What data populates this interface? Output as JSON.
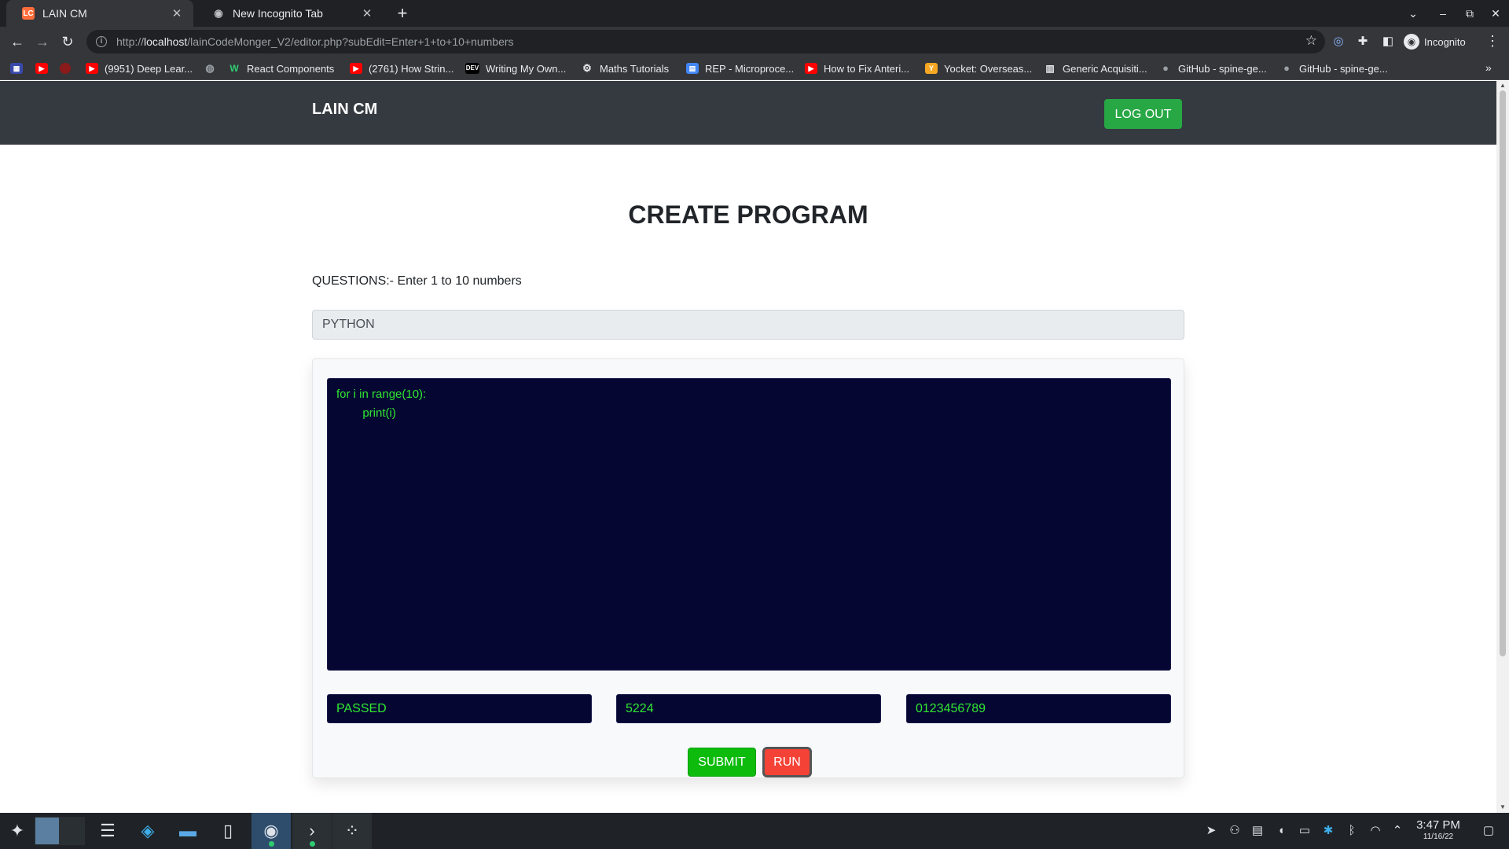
{
  "browser": {
    "tabs": [
      {
        "label": "LAIN CM",
        "favicon": "LC"
      },
      {
        "label": "New Incognito Tab",
        "favicon": "incognito-icon"
      }
    ],
    "url_prefix": "http://",
    "url_host": "localhost",
    "url_path": "/lainCodeMonger_V2/editor.php?subEdit=Enter+1+to+10+numbers",
    "profile_label": "Incognito",
    "bookmarks": [
      {
        "label": "",
        "icon": "calendar-icon"
      },
      {
        "label": "",
        "icon": "youtube-icon"
      },
      {
        "label": "",
        "icon": "circle-icon"
      },
      {
        "label": "(9951) Deep Lear...",
        "icon": "youtube-icon"
      },
      {
        "label": "",
        "icon": "globe-icon"
      },
      {
        "label": "React Components",
        "icon": "w-icon"
      },
      {
        "label": "(2761) How Strin...",
        "icon": "youtube-icon"
      },
      {
        "label": "Writing My Own...",
        "icon": "dev-icon"
      },
      {
        "label": "Maths Tutorials",
        "icon": "gear-icon"
      },
      {
        "label": "REP - Microproce...",
        "icon": "doc-icon"
      },
      {
        "label": "How to Fix Anteri...",
        "icon": "youtube-icon"
      },
      {
        "label": "Yocket: Overseas...",
        "icon": "yocket-icon"
      },
      {
        "label": "Generic Acquisiti...",
        "icon": "doc-icon"
      },
      {
        "label": "GitHub - spine-ge...",
        "icon": "github-icon"
      },
      {
        "label": "GitHub - spine-ge...",
        "icon": "github-icon"
      }
    ]
  },
  "site": {
    "brand": "LAIN CM",
    "logout_label": "LOG OUT"
  },
  "page": {
    "title": "CREATE PROGRAM",
    "question": "QUESTIONS:- Enter 1 to 10 numbers",
    "language": "PYTHON",
    "code": "for i in range(10):\n\tprint(i)",
    "results": {
      "status": "PASSED",
      "runtime": "5224",
      "output": "0123456789"
    },
    "submit_label": "SUBMIT",
    "run_label": "RUN"
  },
  "colors": {
    "nav_bg": "#343a40",
    "success": "#28a745",
    "editor_bg": "#060633",
    "code_text": "#30e830",
    "run_red": "#f44336"
  },
  "taskbar": {
    "time": "3:47 PM",
    "date": "11/16/22"
  }
}
